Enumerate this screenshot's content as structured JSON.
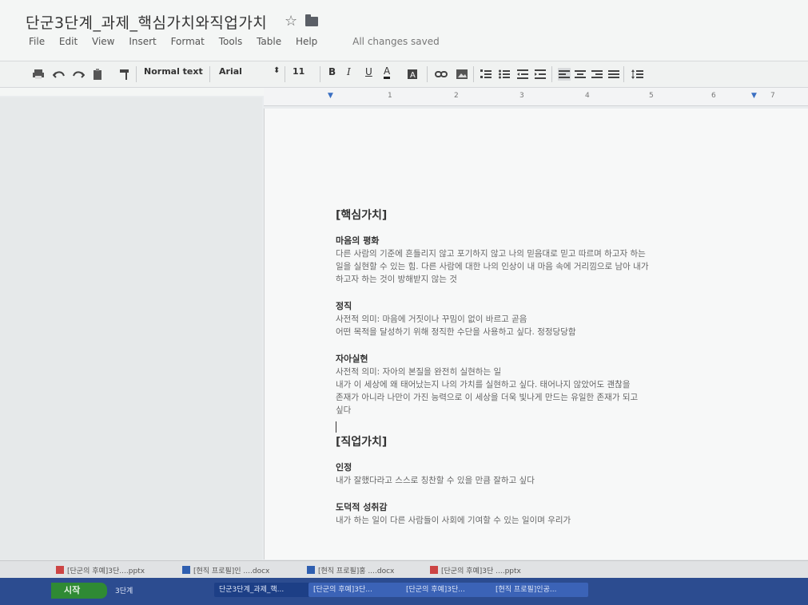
{
  "doc": {
    "title": "단군3단계_과제_핵심가치와직업가치",
    "star": "☆"
  },
  "menu": {
    "items": [
      "File",
      "Edit",
      "View",
      "Insert",
      "Format",
      "Tools",
      "Table",
      "Help"
    ],
    "status": "All changes saved"
  },
  "toolbar": {
    "style": "Normal text",
    "font": "Arial",
    "size": "11",
    "bold": "B",
    "italic": "I",
    "underline": "U",
    "textcolor": "A"
  },
  "ruler": {
    "marks": [
      "1",
      "2",
      "3",
      "4",
      "5",
      "6",
      "7"
    ]
  },
  "content": {
    "heading1": "[핵심가치]",
    "sections": [
      {
        "title": "마음의 평화",
        "lines": [
          "다른 사람의 기준에 흔들리지 않고 포기하지 않고 나의 믿음대로 믿고 따르며 하고자 하는",
          "일을 실현할 수 있는 힘. 다른 사람에 대한 나의 인상이 내 마음 속에 거리낌으로 남아 내가",
          "하고자 하는 것이 방해받지 않는 것"
        ]
      },
      {
        "title": "정직",
        "lines": [
          "사전적 의미: 마음에 거짓이나 꾸밈이 없이 바르고 곧음",
          "어떤 목적을 달성하기 위해 정직한 수단을 사용하고 싶다. 정정당당함"
        ]
      },
      {
        "title": "자아실현",
        "lines": [
          "사전적 의미: 자아의 본질을 완전히 실현하는 일",
          "내가 이 세상에 왜 태어났는지 나의 가치를 실현하고 싶다. 태어나지 않았어도 괜찮을",
          "존재가 아니라 나만이 가진 능력으로 이 세상을 더욱 빛나게 만드는 유일한 존재가 되고",
          "싶다"
        ]
      }
    ],
    "heading2": "[직업가치]",
    "sections2": [
      {
        "title": "인정",
        "lines": [
          "내가 잘했다라고 스스로 칭찬할 수 있을 만큼 잘하고 싶다"
        ]
      },
      {
        "title": "도덕적 성취감",
        "lines": [
          "내가 하는 일이 다른 사람들이 사회에 기여할 수 있는 일이며 우리가"
        ]
      }
    ]
  },
  "downloads": [
    {
      "label": "[단군의 후예]3단....pptx"
    },
    {
      "label": "[현직 프로필]인 ....docx"
    },
    {
      "label": "[현직 프로필]홍 ....docx"
    },
    {
      "label": "[단군의 후예]3단 ....pptx"
    }
  ],
  "taskbar": {
    "start": "시작",
    "quick": "3단계",
    "tasks": [
      {
        "label": "단군3단계_과제_핵..."
      },
      {
        "label": "[단군의 후예]3단..."
      },
      {
        "label": "[단군의 후예]3단..."
      },
      {
        "label": "[현직 프로필]인공..."
      }
    ]
  }
}
